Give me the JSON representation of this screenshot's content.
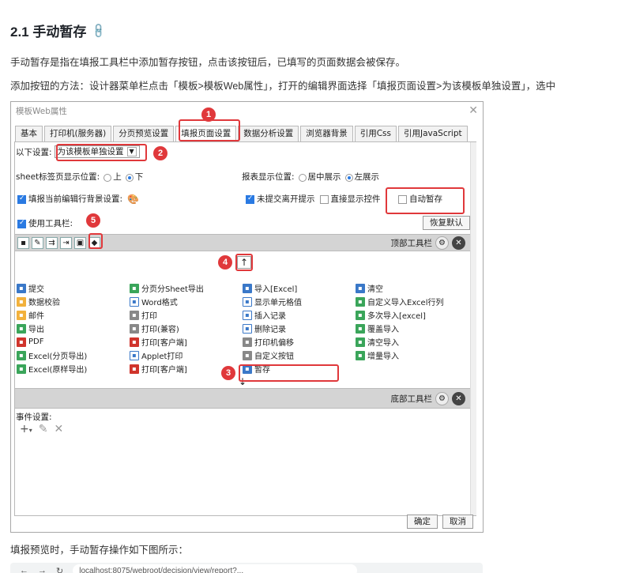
{
  "doc": {
    "heading": "2.1 手动暂存",
    "para1": "手动暂存是指在填报工具栏中添加暂存按钮，点击该按钮后，已填写的页面数据会被保存。",
    "para2": "添加按钮的方法：设计器菜单栏点击「模板>模板Web属性」，打开的编辑界面选择「填报页面设置>为该模板单独设置」，选中",
    "para3": "填报预览时，手动暂存操作如下图所示："
  },
  "dialog": {
    "title": "模板Web属性",
    "tabs": [
      "基本",
      "打印机(服务器)",
      "分页预览设置",
      "填报页面设置",
      "数据分析设置",
      "浏览器背景",
      "引用Css",
      "引用JavaScript"
    ],
    "settings_label": "以下设置:",
    "settings_value": "为该模板单独设置",
    "sheet_pos_label": "sheet标签页显示位置:",
    "sheet_pos_opt1": "上",
    "sheet_pos_opt2": "下",
    "report_pos_label": "报表显示位置:",
    "report_pos_opt1": "居中展示",
    "report_pos_opt2": "左展示",
    "fill_bg_label": "填报当前编辑行背景设置:",
    "unsubmitted_label": "未提交离开提示",
    "direct_show_label": "直接显示控件",
    "auto_save_label": "自动暂存",
    "use_toolbar_label": "使用工具栏:",
    "restore_default": "恢复默认",
    "top_toolbar": "顶部工具栏",
    "bottom_toolbar": "底部工具栏",
    "event_settings": "事件设置:",
    "ok": "确定",
    "cancel": "取消"
  },
  "grid": [
    [
      {
        "icon": "blue",
        "t": "提交"
      },
      {
        "icon": "green",
        "t": "分页分Sheet导出"
      },
      {
        "icon": "blue",
        "t": "导入[Excel]"
      },
      {
        "icon": "blue",
        "t": "清空"
      }
    ],
    [
      {
        "icon": "orange",
        "t": "数据校验"
      },
      {
        "icon": "line",
        "t": "Word格式"
      },
      {
        "icon": "line",
        "t": "显示单元格值"
      },
      {
        "icon": "green",
        "t": "自定义导入Excel行列"
      }
    ],
    [
      {
        "icon": "orange",
        "t": "邮件"
      },
      {
        "icon": "gray",
        "t": "打印"
      },
      {
        "icon": "line",
        "t": "插入记录"
      },
      {
        "icon": "green",
        "t": "多次导入[excel]"
      }
    ],
    [
      {
        "icon": "green",
        "t": "导出"
      },
      {
        "icon": "gray",
        "t": "打印(兼容)"
      },
      {
        "icon": "line",
        "t": "删除记录"
      },
      {
        "icon": "green",
        "t": "覆盖导入"
      }
    ],
    [
      {
        "icon": "red",
        "t": "PDF"
      },
      {
        "icon": "red",
        "t": "打印[客户端]"
      },
      {
        "icon": "gray",
        "t": "打印机偏移"
      },
      {
        "icon": "green",
        "t": "清空导入"
      }
    ],
    [
      {
        "icon": "green",
        "t": "Excel(分页导出)"
      },
      {
        "icon": "line",
        "t": "Applet打印"
      },
      {
        "icon": "gray",
        "t": "自定义按钮"
      },
      {
        "icon": "green",
        "t": "增量导入"
      }
    ],
    [
      {
        "icon": "green",
        "t": "Excel(原样导出)"
      },
      {
        "icon": "red",
        "t": "打印[客户端]"
      },
      {
        "icon": "blue",
        "t": "暂存"
      },
      {
        "icon": "",
        "t": ""
      }
    ]
  ],
  "badges": [
    "1",
    "2",
    "3",
    "4",
    "5"
  ],
  "browser": {
    "url": "localhost:8075/webroot/decision/view/report?..."
  }
}
